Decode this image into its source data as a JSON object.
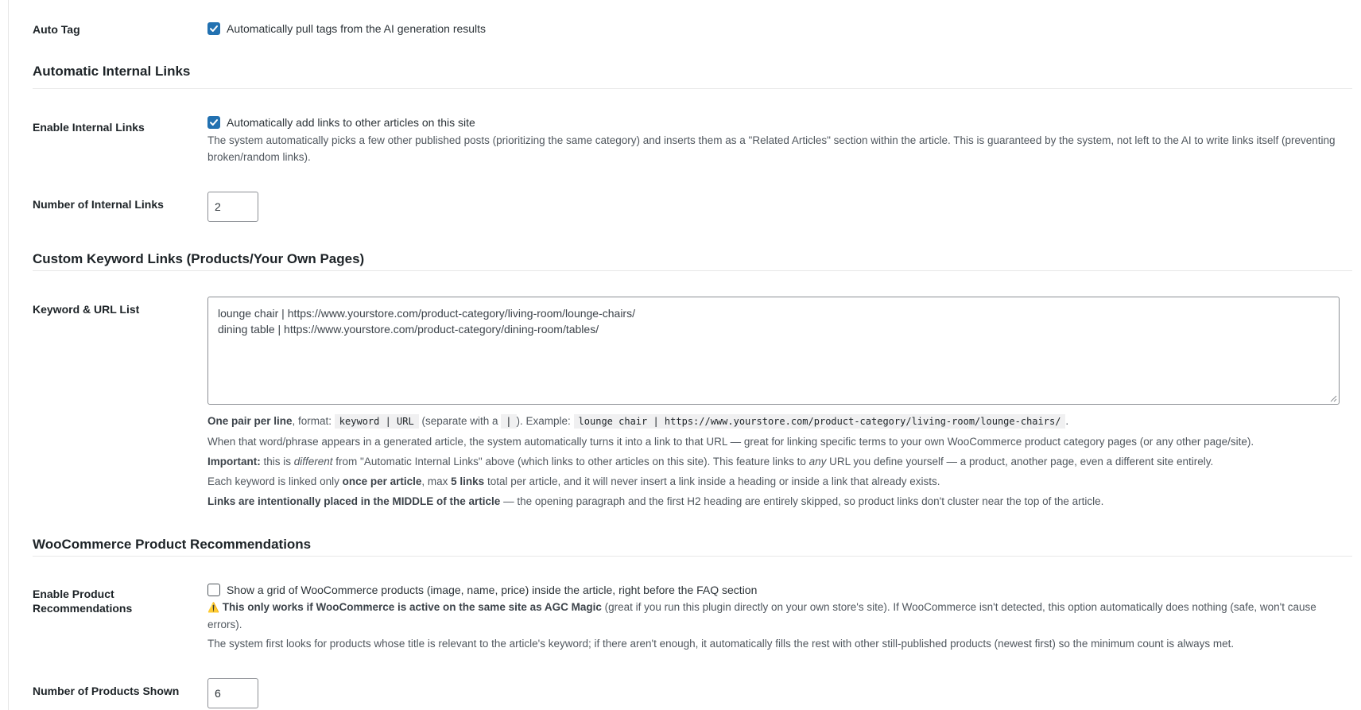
{
  "auto_tag": {
    "label": "Auto Tag",
    "checked": true,
    "checkbox_text": "Automatically pull tags from the AI generation results"
  },
  "internal_links_section": {
    "title": "Automatic Internal Links",
    "enable": {
      "label": "Enable Internal Links",
      "checked": true,
      "checkbox_text": "Automatically add links to other articles on this site",
      "description": "The system automatically picks a few other published posts (prioritizing the same category) and inserts them as a \"Related Articles\" section within the article. This is guaranteed by the system, not left to the AI to write links itself (preventing broken/random links)."
    },
    "count": {
      "label": "Number of Internal Links",
      "value": "2"
    }
  },
  "keyword_section": {
    "title": "Custom Keyword Links (Products/Your Own Pages)",
    "list": {
      "label": "Keyword & URL List",
      "lines": [
        "lounge chair | https://www.yourstore.com/product-category/living-room/lounge-chairs/",
        "dining table | https://www.yourstore.com/product-category/dining-room/tables/"
      ]
    },
    "help": {
      "p1_bold": "One pair per line",
      "p1_a": ", format: ",
      "p1_code1": "keyword | URL",
      "p1_b": " (separate with a ",
      "p1_code2": "|",
      "p1_c": "). Example: ",
      "p1_code3": "lounge chair | https://www.yourstore.com/product-category/living-room/lounge-chairs/",
      "p1_d": ".",
      "p2": "When that word/phrase appears in a generated article, the system automatically turns it into a link to that URL — great for linking specific terms to your own WooCommerce product category pages (or any other page/site).",
      "p3_bold": "Important:",
      "p3_a": " this is ",
      "p3_em1": "different",
      "p3_b": " from \"Automatic Internal Links\" above (which links to other articles on this site). This feature links to ",
      "p3_em2": "any",
      "p3_c": " URL you define yourself — a product, another page, even a different site entirely.",
      "p4_a": "Each keyword is linked only ",
      "p4_bold1": "once per article",
      "p4_b": ", max ",
      "p4_bold2": "5 links",
      "p4_c": " total per article, and it will never insert a link inside a heading or inside a link that already exists.",
      "p5_bold": "Links are intentionally placed in the MIDDLE of the article",
      "p5_a": " — the opening paragraph and the first H2 heading are entirely skipped, so product links don't cluster near the top of the article."
    }
  },
  "woo_section": {
    "title": "WooCommerce Product Recommendations",
    "enable": {
      "label": "Enable Product Recommendations",
      "checked": false,
      "checkbox_text": "Show a grid of WooCommerce products (image, name, price) inside the article, right before the FAQ section",
      "warning_icon": "⚠️",
      "warning_bold": "This only works if WooCommerce is active on the same site as AGC Magic",
      "warning_rest": " (great if you run this plugin directly on your own store's site). If WooCommerce isn't detected, this option automatically does nothing (safe, won't cause errors).",
      "note": "The system first looks for products whose title is relevant to the article's keyword; if there aren't enough, it automatically fills the rest with other still-published products (newest first) so the minimum count is always met."
    },
    "count": {
      "label": "Number of Products Shown",
      "value": "6"
    }
  },
  "colors": {
    "accent": "#2271b1",
    "text": "#1d2327",
    "muted": "#50575e"
  }
}
